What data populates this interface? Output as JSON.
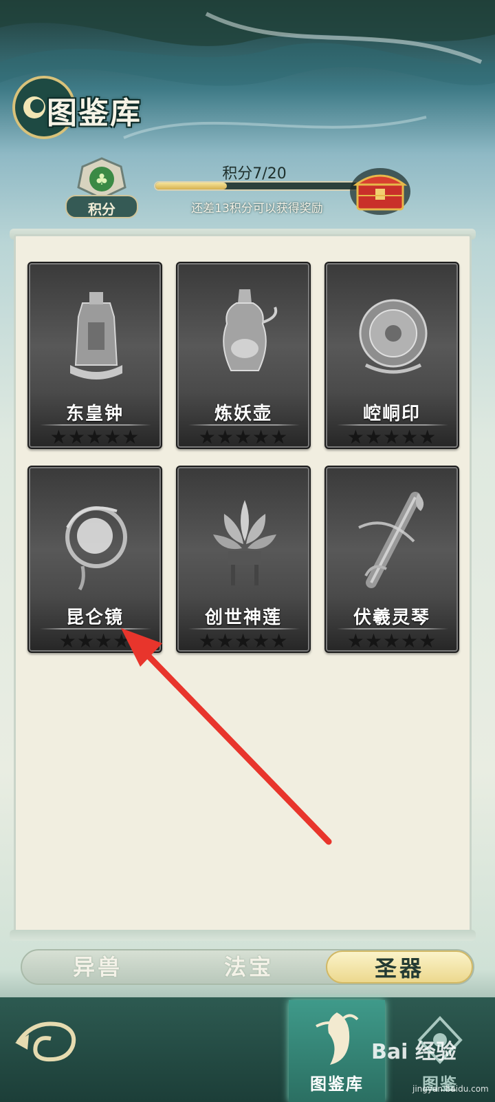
{
  "header": {
    "title": "图鉴库"
  },
  "points": {
    "badge_label": "积分",
    "score_text": "积分7/20",
    "progress": 0.35,
    "hint": "还差13积分可以获得奖励"
  },
  "cards": [
    {
      "name": "东皇钟",
      "stars": "★★★★★",
      "icon": "bell-icon"
    },
    {
      "name": "炼妖壶",
      "stars": "★★★★★",
      "icon": "pot-icon"
    },
    {
      "name": "崆峒印",
      "stars": "★★★★★",
      "icon": "seal-icon"
    },
    {
      "name": "昆仑镜",
      "stars": "★★★★",
      "icon": "mirror-icon"
    },
    {
      "name": "创世神莲",
      "stars": "★★★★★",
      "icon": "lotus-icon"
    },
    {
      "name": "伏羲灵琴",
      "stars": "★★★★★",
      "icon": "zither-icon"
    }
  ],
  "tabs": [
    {
      "label": "异兽",
      "active": false
    },
    {
      "label": "法宝",
      "active": false
    },
    {
      "label": "圣器",
      "active": true
    }
  ],
  "bottom_nav": {
    "active_label": "图鉴库",
    "second_label": "图鉴"
  },
  "watermark": {
    "main": "Bai 经验",
    "sub": "jingyan.baidu.com"
  },
  "colors": {
    "accent": "#ecd88e",
    "arrow": "#e8352c",
    "card_dark": "#3a3a3a"
  }
}
